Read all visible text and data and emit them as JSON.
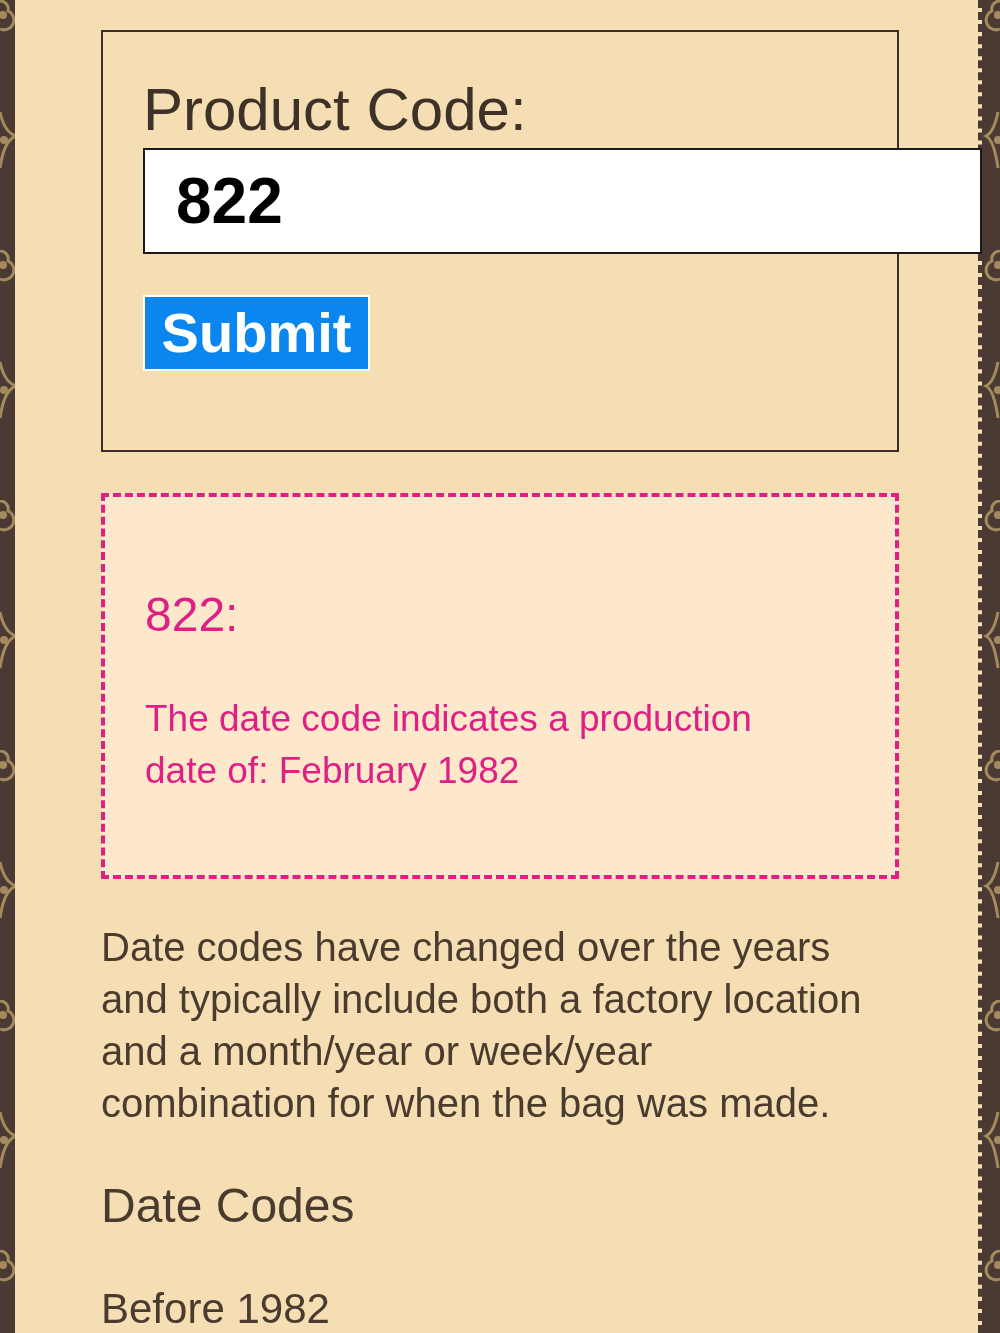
{
  "form": {
    "label": "Product Code:",
    "input": {
      "value": "822"
    },
    "submit_button": "Submit"
  },
  "result": {
    "code": "822:",
    "message": "The date code indicates a production date of: February 1982"
  },
  "intro": "Date codes have changed over the years and typically include both a factory location and a month/year or week/year combination for when the bag was made.",
  "heading": "Date Codes",
  "subheading": "Before 1982"
}
